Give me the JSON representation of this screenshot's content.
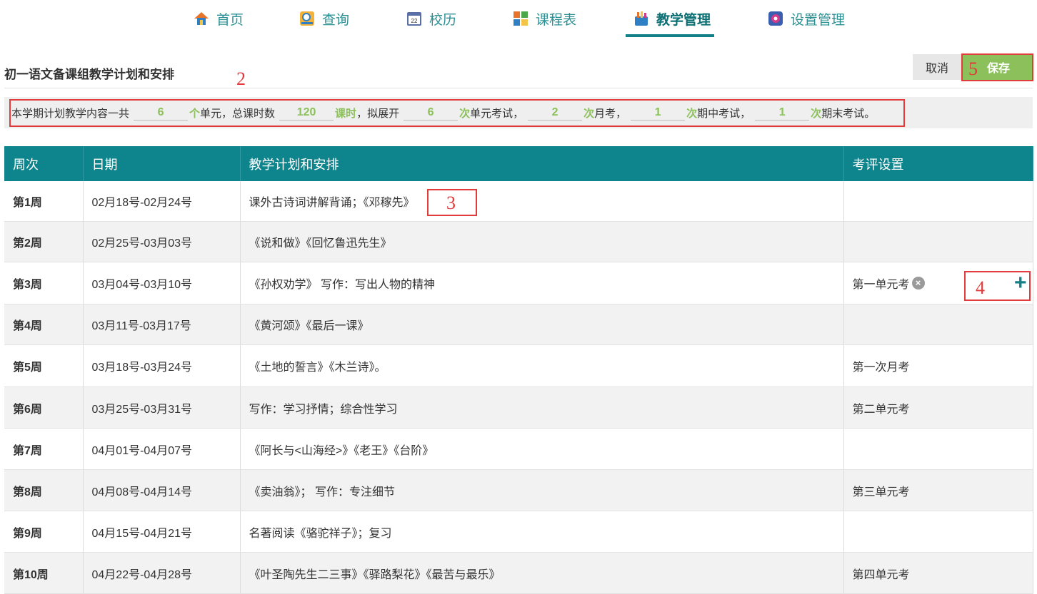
{
  "nav": {
    "items": [
      {
        "label": "首页",
        "icon": "home-icon"
      },
      {
        "label": "查询",
        "icon": "query-icon"
      },
      {
        "label": "校历",
        "icon": "calendar-icon"
      },
      {
        "label": "课程表",
        "icon": "timetable-icon"
      },
      {
        "label": "教学管理",
        "icon": "teaching-icon",
        "active": true
      },
      {
        "label": "设置管理",
        "icon": "settings-icon"
      }
    ]
  },
  "page": {
    "title": "初一语文备课组教学计划和安排",
    "cancel_label": "取消",
    "save_label": "保存"
  },
  "annotations": [
    "2",
    "3",
    "4",
    "5"
  ],
  "summary": {
    "prefix": "本学期计划教学内容一共",
    "units_value": "6",
    "units_unit": "个",
    "units_suffix": "单元，总课时数",
    "hours_value": "120",
    "hours_unit": "课时",
    "hours_suffix": "，拟展开",
    "unit_exam_value": "6",
    "unit_exam_unit": "次",
    "unit_exam_suffix": "单元考试，",
    "monthly_value": "2",
    "monthly_unit": "次",
    "monthly_suffix": "月考，",
    "midterm_value": "1",
    "midterm_unit": "次",
    "midterm_suffix": "期中考试，",
    "final_value": "1",
    "final_unit": "次",
    "final_suffix": "期末考试。"
  },
  "table": {
    "headers": [
      "周次",
      "日期",
      "教学计划和安排",
      "考评设置"
    ],
    "rows": [
      {
        "week": "第1周",
        "date": "02月18号-02月24号",
        "plan": "课外古诗词讲解背诵；《邓稼先》",
        "eval": ""
      },
      {
        "week": "第2周",
        "date": "02月25号-03月03号",
        "plan": "《说和做》《回忆鲁迅先生》",
        "eval": ""
      },
      {
        "week": "第3周",
        "date": "03月04号-03月10号",
        "plan": "《孙权劝学》 写作：写出人物的精神",
        "eval": "第一单元考"
      },
      {
        "week": "第4周",
        "date": "03月11号-03月17号",
        "plan": "《黄河颂》《最后一课》",
        "eval": ""
      },
      {
        "week": "第5周",
        "date": "03月18号-03月24号",
        "plan": "《土地的誓言》《木兰诗》。",
        "eval": "第一次月考"
      },
      {
        "week": "第6周",
        "date": "03月25号-03月31号",
        "plan": "写作：学习抒情；综合性学习",
        "eval": "第二单元考"
      },
      {
        "week": "第7周",
        "date": "04月01号-04月07号",
        "plan": "《阿长与<山海经>》《老王》《台阶》",
        "eval": ""
      },
      {
        "week": "第8周",
        "date": "04月08号-04月14号",
        "plan": "《卖油翁》； 写作：专注细节",
        "eval": "第三单元考"
      },
      {
        "week": "第9周",
        "date": "04月15号-04月21号",
        "plan": "名著阅读《骆驼祥子》；复习",
        "eval": ""
      },
      {
        "week": "第10周",
        "date": "04月22号-04月28号",
        "plan": "《叶圣陶先生二三事》《驿路梨花》《最苦与最乐》",
        "eval": "第四单元考"
      }
    ]
  }
}
